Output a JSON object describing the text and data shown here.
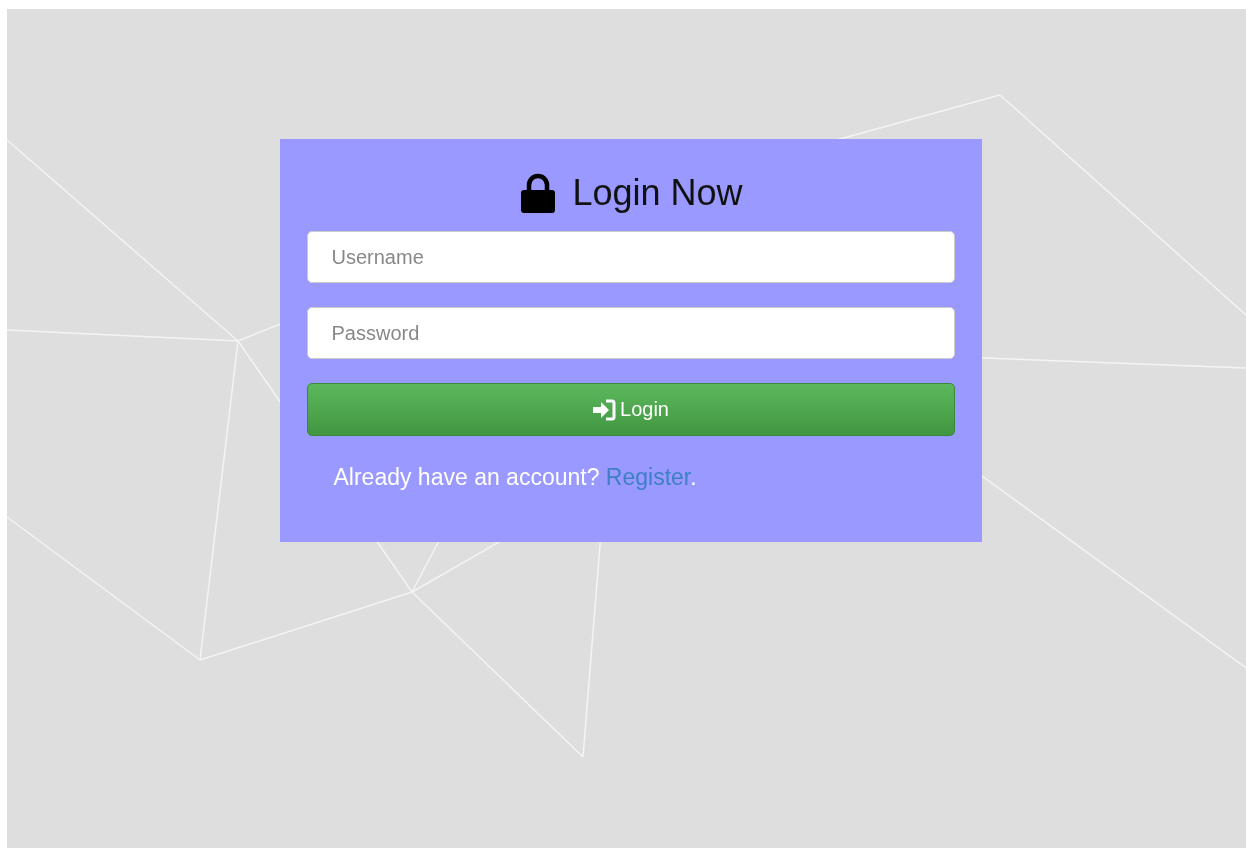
{
  "login": {
    "title": "Login Now",
    "fields": [
      {
        "placeholder": "Username"
      },
      {
        "placeholder": "Password"
      }
    ],
    "button": "Login",
    "footer": {
      "text": "Already have an account?",
      "link": "Register",
      "end": "."
    }
  }
}
